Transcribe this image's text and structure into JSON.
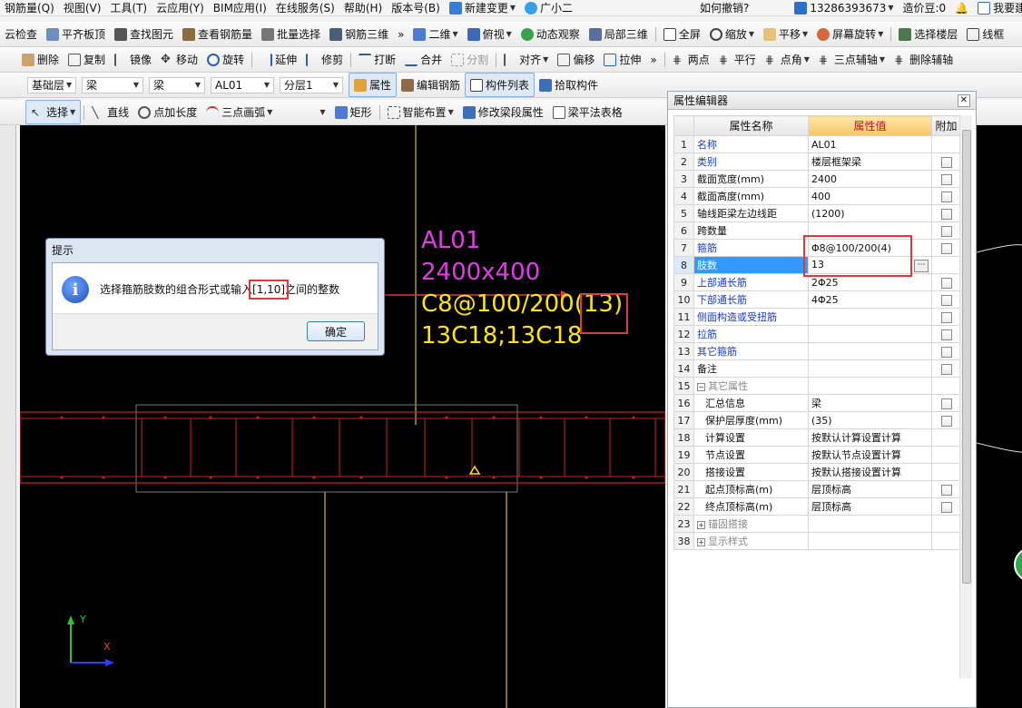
{
  "menubar": {
    "items": [
      "钢筋量(Q)",
      "视图(V)",
      "工具(T)",
      "云应用(Y)",
      "BIM应用(I)",
      "在线服务(S)",
      "帮助(H)",
      "版本号(B)",
      "新建变更",
      "广小二"
    ],
    "help_prompt": "如何撤销?",
    "phone": "13286393673",
    "cost_beans": "造价豆:0",
    "suggest": "我要建议"
  },
  "toolbar1": [
    "云检查",
    "平齐板顶",
    "查找图元",
    "查看钢筋量",
    "批量选择",
    "钢筋三维",
    "二维",
    "俯视",
    "动态观察",
    "局部三维",
    "全屏",
    "缩放",
    "平移",
    "屏幕旋转",
    "选择楼层",
    "线框"
  ],
  "toolbar2": [
    "删除",
    "复制",
    "镜像",
    "移动",
    "旋转",
    "延伸",
    "修剪",
    "打断",
    "合并",
    "分割",
    "对齐",
    "偏移",
    "拉伸",
    "两点",
    "平行",
    "点角",
    "三点辅轴",
    "删除辅轴"
  ],
  "toolbar3": {
    "floor": "基础层",
    "type1": "梁",
    "type2": "梁",
    "component": "AL01",
    "layer": "分层1",
    "buttons": [
      "属性",
      "编辑钢筋",
      "构件列表",
      "拾取构件"
    ]
  },
  "toolbar4": [
    "选择",
    "直线",
    "点加长度",
    "三点画弧",
    "矩形",
    "智能布置",
    "修改梁段属性",
    "梁平法表格"
  ],
  "canvas": {
    "annotation": [
      "AL01",
      "2400x400",
      "C8@100/200(13)",
      "13C18;13C18"
    ],
    "annotation_main": "C8@100/200",
    "annotation_legs": "(13)",
    "axis_x": "X",
    "axis_y": "Y"
  },
  "dialog": {
    "title": "提示",
    "message_before": "选择箍筋肢数的组合形式或输入",
    "message_range": "[1,10]",
    "message_after": "之间的整数",
    "ok": "确定"
  },
  "prop_editor": {
    "title": "属性编辑器",
    "headers": [
      "属性名称",
      "属性值",
      "附加"
    ],
    "rows": [
      {
        "no": "1",
        "name": "名称",
        "value": "AL01",
        "check": false,
        "style": "link"
      },
      {
        "no": "2",
        "name": "类别",
        "value": "楼层框架梁",
        "check": true,
        "style": "link"
      },
      {
        "no": "3",
        "name": "截面宽度(mm)",
        "value": "2400",
        "check": true,
        "style": "plain"
      },
      {
        "no": "4",
        "name": "截面高度(mm)",
        "value": "400",
        "check": true,
        "style": "plain"
      },
      {
        "no": "5",
        "name": "轴线距梁左边线距",
        "value": "(1200)",
        "check": true,
        "style": "plain"
      },
      {
        "no": "6",
        "name": "跨数量",
        "value": "",
        "check": true,
        "style": "plain"
      },
      {
        "no": "7",
        "name": "箍筋",
        "value": "Φ8@100/200(4)",
        "check": true,
        "style": "link"
      },
      {
        "no": "8",
        "name": "肢数",
        "value": "13",
        "check": false,
        "style": "link",
        "highlight": true
      },
      {
        "no": "9",
        "name": "上部通长筋",
        "value": "2Φ25",
        "check": true,
        "style": "link"
      },
      {
        "no": "10",
        "name": "下部通长筋",
        "value": "4Φ25",
        "check": true,
        "style": "link"
      },
      {
        "no": "11",
        "name": "侧面构造或受扭筋",
        "value": "",
        "check": true,
        "style": "link"
      },
      {
        "no": "12",
        "name": "拉筋",
        "value": "",
        "check": true,
        "style": "link"
      },
      {
        "no": "13",
        "name": "其它箍筋",
        "value": "",
        "check": true,
        "style": "link"
      },
      {
        "no": "14",
        "name": "备注",
        "value": "",
        "check": true,
        "style": "plain"
      },
      {
        "no": "15",
        "name": "其它属性",
        "value": "",
        "check": false,
        "style": "group",
        "tree": "−"
      },
      {
        "no": "16",
        "name": "汇总信息",
        "value": "梁",
        "check": true,
        "style": "sub"
      },
      {
        "no": "17",
        "name": "保护层厚度(mm)",
        "value": "(35)",
        "check": true,
        "style": "sub"
      },
      {
        "no": "18",
        "name": "计算设置",
        "value": "按默认计算设置计算",
        "check": false,
        "style": "sub"
      },
      {
        "no": "19",
        "name": "节点设置",
        "value": "按默认节点设置计算",
        "check": false,
        "style": "sub"
      },
      {
        "no": "20",
        "name": "搭接设置",
        "value": "按默认搭接设置计算",
        "check": false,
        "style": "sub"
      },
      {
        "no": "21",
        "name": "起点顶标高(m)",
        "value": "层顶标高",
        "check": true,
        "style": "sub"
      },
      {
        "no": "22",
        "name": "终点顶标高(m)",
        "value": "层顶标高",
        "check": true,
        "style": "sub"
      },
      {
        "no": "23",
        "name": "锚固搭接",
        "value": "",
        "check": false,
        "style": "group",
        "tree": "+"
      },
      {
        "no": "38",
        "name": "显示样式",
        "value": "",
        "check": false,
        "style": "group",
        "tree": "+"
      }
    ]
  },
  "colors": {
    "canvas_bg": "#000000",
    "annotation_magenta": "#e23ce6",
    "annotation_yellow": "#ffe600",
    "beam_red": "#d02020",
    "highlight_blue": "#3399ff",
    "callout_red": "#e03a3a"
  }
}
